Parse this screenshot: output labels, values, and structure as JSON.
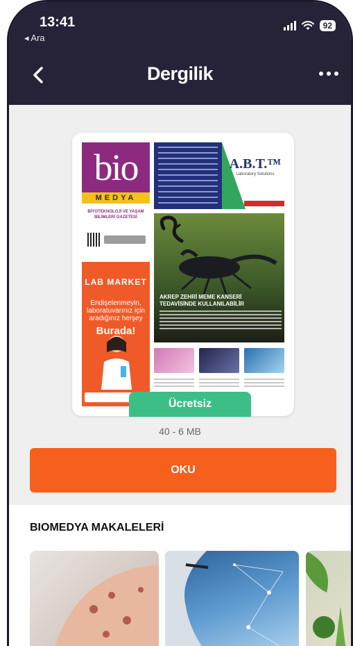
{
  "status_bar": {
    "time": "13:41",
    "back_label": "◂ Ara",
    "battery": "92"
  },
  "header": {
    "title": "Dergilik"
  },
  "cover": {
    "brand_big": "bio",
    "brand_bar": "MEDYA",
    "subtitle": "BİYOTEKNOLOJİ VE YAŞAM BİLİMLERİ GAZETESİ",
    "abt_logo": "A.B.T.™",
    "abt_sub": "Laboratory Solutions",
    "lab_logo": "LAB MARKET",
    "lab_text": "Endişelenmeyin, laboratuvarınız için aradığınız herşey",
    "lab_cta": "Burada!",
    "article_title": "AKREP ZEHRİ MEME KANSERİ TEDAVİSİNDE KULLANILABİLİR"
  },
  "issue": {
    "price_tag": "Ücretsiz",
    "size": "40 - 6 MB",
    "read_label": "OKU"
  },
  "articles": {
    "section_title": "BIOMEDYA MAKALELERİ"
  },
  "colors": {
    "header_bg": "#262338",
    "accent_orange": "#f7601c",
    "free_green": "#3dbe87"
  }
}
